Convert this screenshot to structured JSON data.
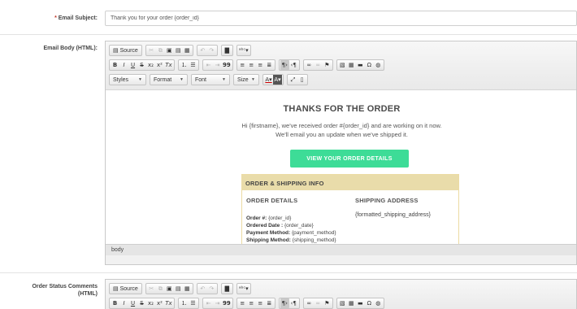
{
  "fields": {
    "subject": {
      "required_mark": "*",
      "label": "Email Subject:",
      "value": "Thank you for your order {order_id}"
    },
    "body": {
      "label": "Email Body (HTML):"
    },
    "comments": {
      "label_line1": "Order Status Comments",
      "label_line2": "(HTML)"
    }
  },
  "toolbar": {
    "source_label": "Source",
    "styles_label": "Styles",
    "format_label": "Format",
    "font_label": "Font",
    "size_label": "Size",
    "icons": {
      "bold": "B",
      "italic": "I",
      "underline": "U",
      "strike": "S",
      "subscript": "x₂",
      "superscript": "x²",
      "remove_format": "Tx",
      "blockquote": "99"
    }
  },
  "email": {
    "title": "THANKS FOR THE ORDER",
    "intro_line1": "Hi {firstname}, we've received order #{order_id} and are working on it now.",
    "intro_line2": "We'll email you an update when we've shipped it.",
    "cta_label": "VIEW YOUR ORDER DETAILS",
    "section_title": "ORDER & SHIPPING INFO",
    "order_details": {
      "heading": "ORDER DETAILS",
      "order_no_label": "Order #:",
      "order_no_value": "{order_id}",
      "ordered_date_label": "Ordered Date :",
      "ordered_date_value": "{order_date}",
      "payment_label": "Payment Method:",
      "payment_value": "{payment_method}",
      "shipping_label": "Shipping Method:",
      "shipping_value": "{shipping_method}"
    },
    "shipping_address": {
      "heading": "SHIPPING ADDRESS",
      "value": "{formatted_shipping_address}"
    }
  },
  "statusbar": {
    "path": "body"
  },
  "colors": {
    "cta": "#3ddc97",
    "section_header": "#e9dcaa",
    "required": "#c0392b"
  }
}
